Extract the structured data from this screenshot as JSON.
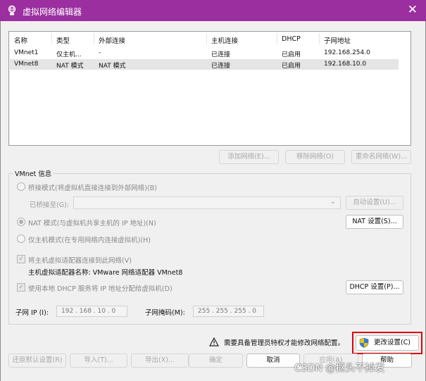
{
  "window": {
    "title": "虚拟网络编辑器",
    "close_glyph": "✕",
    "accent": "#9b2fa0"
  },
  "network_table": {
    "columns": [
      "名称",
      "类型",
      "外部连接",
      "主机连接",
      "DHCP",
      "子网地址"
    ],
    "rows": [
      [
        "VMnet1",
        "仅主机...",
        "-",
        "已连接",
        "已启用",
        "192.168.254.0"
      ],
      [
        "VMnet8",
        "NAT 模式",
        "NAT 模式",
        "已连接",
        "已启用",
        "192.168.10.0"
      ]
    ]
  },
  "list_buttons": {
    "add": "添加网络(E)...",
    "remove": "移除网络(O)",
    "rename": "重命名网络(W)..."
  },
  "vmnet_info": {
    "legend": "VMnet 信息",
    "bridged_option": "桥接模式(将虚拟机直接连接到外部网络)(B)",
    "bridged_to_label": "已桥接至(G):",
    "bridged_to_value": "",
    "auto_settings": "自动设置(U)...",
    "nat_option": "NAT 模式(与虚拟机共享主机的 IP 地址)(N)",
    "nat_settings": "NAT 设置(S)...",
    "hostonly_option": "仅主机模式(在专用网络内连接虚拟机)(H)",
    "connect_adapter": "将主机虚拟适配器连接到此网络(V)",
    "adapter_name": "主机虚拟适配器名称: VMware 网络适配器 VMnet8",
    "use_dhcp": "使用本地 DHCP 服务将 IP 地址分配给虚拟机(D)",
    "dhcp_settings": "DHCP 设置(P)...",
    "subnet_ip_label": "子网 IP (I):",
    "subnet_ip_value": "192 . 168 . 10 . 0",
    "subnet_mask_label": "子网掩码(M):",
    "subnet_mask_value": "255 . 255 . 255 . 0"
  },
  "admin_notice": "需要具备管理员特权才能修改网络配置。",
  "change_settings": "更改设置(C)",
  "footer_buttons": {
    "restore": "还原默认设置(R)",
    "import": "导入(T)...",
    "export": "导出(X)...",
    "ok": "确定",
    "cancel": "取消",
    "apply": "应用(A)",
    "help": "帮助"
  },
  "watermark": "CSDN @抠头不掉发"
}
